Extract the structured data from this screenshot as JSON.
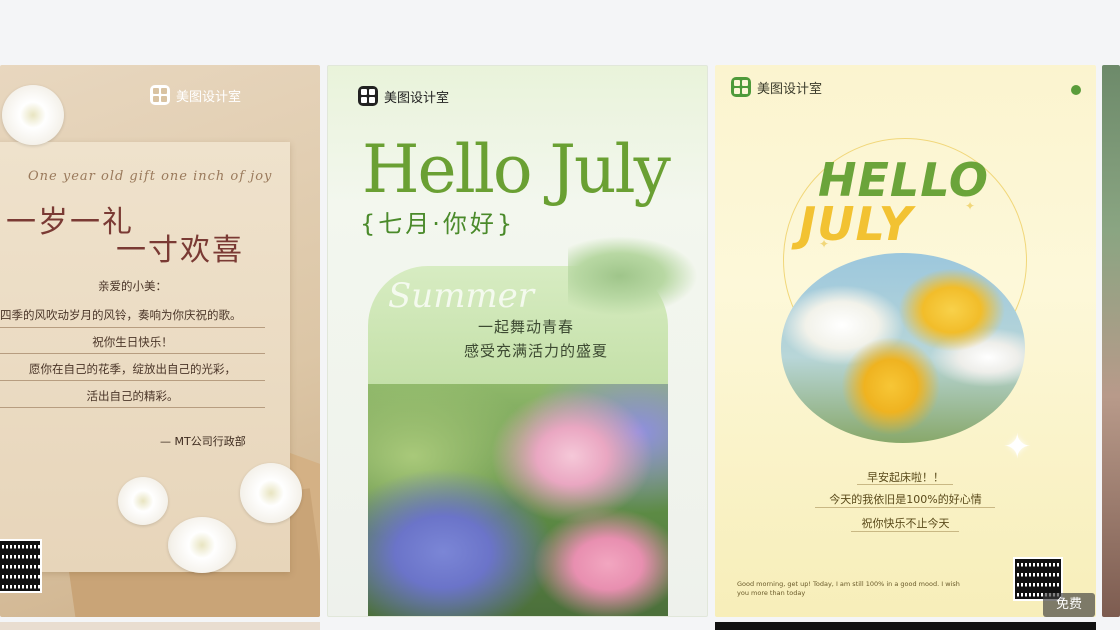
{
  "brand": {
    "name": "美图设计室"
  },
  "colors": {
    "background": "#f4f5f7",
    "card2_accent": "#6aa033",
    "card3_green": "#6ba43a",
    "card3_yellow": "#f2c232",
    "card1_title": "#7a3a34"
  },
  "cards": [
    {
      "script": "One year old gift one inch of joy",
      "title_line1": "一岁一礼",
      "title_line2": "一寸欢喜",
      "greeting": "亲爱的小美：",
      "lines": [
        "四季的风吹动岁月的风铃，奏响为你庆祝的歌。",
        "祝你生日快乐！",
        "愿你在自己的花季，绽放出自己的光彩，",
        "活出自己的精彩。"
      ],
      "signature": "— MT公司行政部"
    },
    {
      "title": "Hello July",
      "subtitle": "{七月·你好}",
      "script": "Summer",
      "line1": "一起舞动青春",
      "line2": "感受充满活力的盛夏"
    },
    {
      "hello": "HELLO",
      "july": "JULY",
      "msg1": "早安起床啦！！",
      "msg2": "今天的我依旧是100%的好心情",
      "msg3": "祝你快乐不止今天",
      "small_text": "Good morning, get up! Today, I am still 100% in a good mood. I wish you more than today",
      "badge": "免费"
    }
  ],
  "icons": [
    "brand-logo-icon",
    "qr-code-icon",
    "sparkle-icon"
  ]
}
